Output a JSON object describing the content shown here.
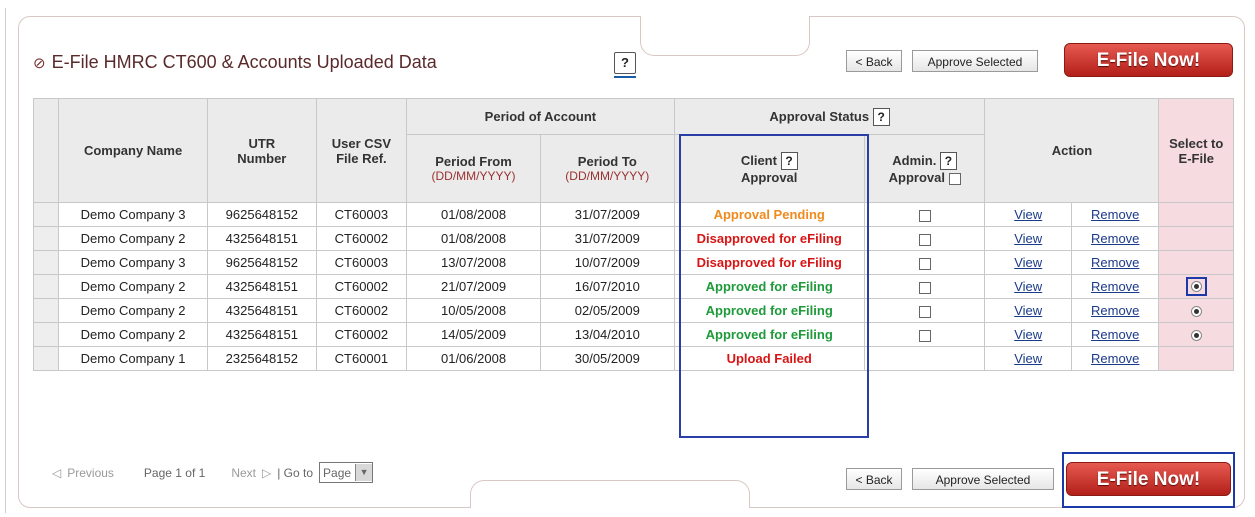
{
  "header": {
    "title": "E-File HMRC CT600 & Accounts Uploaded Data",
    "help": "?",
    "back_label": "< Back",
    "approve_selected_label": "Approve Selected",
    "efile_now_label": "E-File Now!"
  },
  "table": {
    "headers": {
      "company_name": "Company Name",
      "utr_number": "UTR Number",
      "user_csv": "User CSV File Ref.",
      "period_of_account": "Period of Account",
      "period_from": "Period From",
      "period_to": "Period To",
      "date_format_from": "(DD/MM/YYYY)",
      "date_format_to": "(DD/MM/YYYY)",
      "approval_status": "Approval Status",
      "client_line1": "Client",
      "client_line2": "Approval",
      "admin_line1": "Admin.",
      "admin_line2": "Approval",
      "action": "Action",
      "select_line1": "Select to",
      "select_line2": "E-File",
      "help": "?"
    },
    "rows": [
      {
        "company": "Demo Company 3",
        "utr": "9625648152",
        "csv": "CT60003",
        "from": "01/08/2008",
        "to": "31/07/2009",
        "status": "Approval Pending",
        "status_type": "pending",
        "view": "View",
        "remove": "Remove",
        "select": "none"
      },
      {
        "company": "Demo Company 2",
        "utr": "4325648151",
        "csv": "CT60002",
        "from": "01/08/2008",
        "to": "31/07/2009",
        "status": "Disapproved for eFiling",
        "status_type": "dis",
        "view": "View",
        "remove": "Remove",
        "select": "none"
      },
      {
        "company": "Demo Company 3",
        "utr": "9625648152",
        "csv": "CT60003",
        "from": "13/07/2008",
        "to": "10/07/2009",
        "status": "Disapproved for eFiling",
        "status_type": "dis",
        "view": "View",
        "remove": "Remove",
        "select": "none"
      },
      {
        "company": "Demo Company 2",
        "utr": "4325648151",
        "csv": "CT60002",
        "from": "21/07/2009",
        "to": "16/07/2010",
        "status": "Approved for eFiling",
        "status_type": "app",
        "view": "View",
        "remove": "Remove",
        "select": "selected"
      },
      {
        "company": "Demo Company 2",
        "utr": "4325648151",
        "csv": "CT60002",
        "from": "10/05/2008",
        "to": "02/05/2009",
        "status": "Approved for eFiling",
        "status_type": "app",
        "view": "View",
        "remove": "Remove",
        "select": "radio"
      },
      {
        "company": "Demo Company 2",
        "utr": "4325648151",
        "csv": "CT60002",
        "from": "14/05/2009",
        "to": "13/04/2010",
        "status": "Approved for eFiling",
        "status_type": "app",
        "view": "View",
        "remove": "Remove",
        "select": "radio"
      },
      {
        "company": "Demo Company 1",
        "utr": "2325648152",
        "csv": "CT60001",
        "from": "01/06/2008",
        "to": "30/05/2009",
        "status": "Upload Failed",
        "status_type": "fail",
        "view": "View",
        "remove": "Remove",
        "select": "none"
      }
    ]
  },
  "footer": {
    "previous_label": "Previous",
    "page_info": "Page 1 of 1",
    "next_label": "Next",
    "go_to_label": "| Go to",
    "page_select_value": "Page",
    "back_label": "< Back",
    "approve_selected_label": "Approve Selected",
    "efile_now_label": "E-File Now!"
  },
  "colors": {
    "efile_button": "#c8302a",
    "select_column": "#f6dbe0",
    "highlight_frame": "#1b3aa8"
  }
}
